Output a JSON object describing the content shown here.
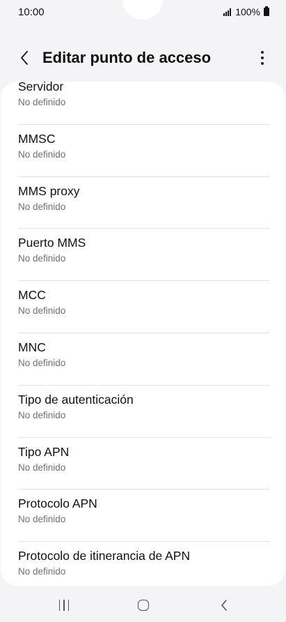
{
  "status_bar": {
    "time": "10:00",
    "battery": "100%"
  },
  "header": {
    "title": "Editar punto de acceso"
  },
  "items": [
    {
      "label": "Servidor",
      "value": "No definido"
    },
    {
      "label": "MMSC",
      "value": "No definido"
    },
    {
      "label": "MMS proxy",
      "value": "No definido"
    },
    {
      "label": "Puerto MMS",
      "value": "No definido"
    },
    {
      "label": "MCC",
      "value": "No definido"
    },
    {
      "label": "MNC",
      "value": "No definido"
    },
    {
      "label": "Tipo de autenticación",
      "value": "No definido"
    },
    {
      "label": "Tipo APN",
      "value": "No definido"
    },
    {
      "label": "Protocolo APN",
      "value": "No definido"
    },
    {
      "label": "Protocolo de itinerancia de APN",
      "value": "No definido"
    }
  ],
  "icons": {
    "back": "chevron-left-icon",
    "more": "more-vertical-icon",
    "signal": "signal-icon",
    "battery": "battery-icon",
    "nav_recents": "recents-icon",
    "nav_home": "home-icon",
    "nav_back": "back-icon"
  },
  "colors": {
    "background": "#f4f4f6",
    "card": "#ffffff",
    "secondary_text": "#707070"
  }
}
